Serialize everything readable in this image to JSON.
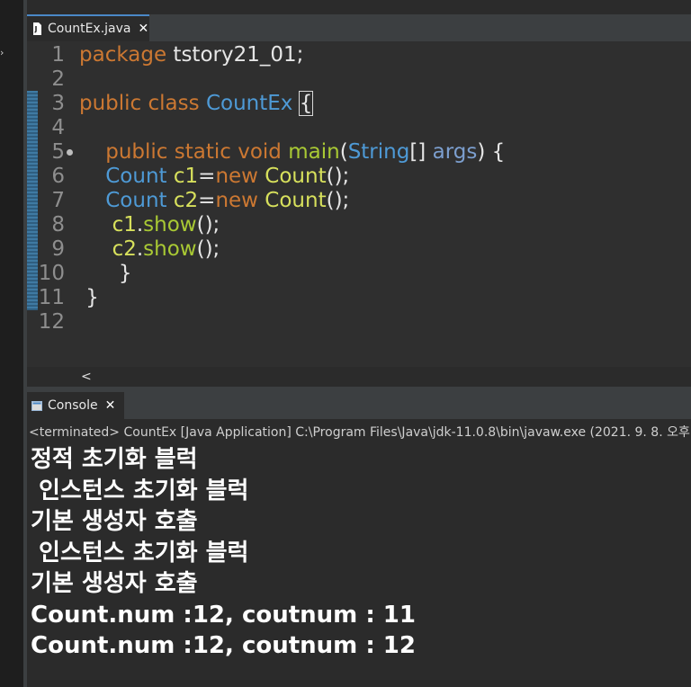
{
  "editor_tab": {
    "title": "CountEx.java",
    "close": "✕",
    "icon": "java-file-icon"
  },
  "editor": {
    "line_numbers": [
      "1",
      "2",
      "3",
      "4",
      "5",
      "6",
      "7",
      "8",
      "9",
      "10",
      "11",
      "12"
    ],
    "lines": [
      {
        "parts": [
          {
            "text": "package",
            "cls": "k"
          },
          {
            "text": " tstory21_01;",
            "cls": "w"
          }
        ]
      },
      {
        "parts": []
      },
      {
        "parts": [
          {
            "text": "public",
            "cls": "k"
          },
          {
            "text": " ",
            "cls": "w"
          },
          {
            "text": "class",
            "cls": "k"
          },
          {
            "text": " ",
            "cls": "w"
          },
          {
            "text": "CountEx",
            "cls": "t"
          },
          {
            "text": " ",
            "cls": "w"
          },
          {
            "text": "{",
            "cls": "w box"
          }
        ]
      },
      {
        "parts": []
      },
      {
        "parts": [
          {
            "text": "    ",
            "cls": "w"
          },
          {
            "text": "public",
            "cls": "k"
          },
          {
            "text": " ",
            "cls": "w"
          },
          {
            "text": "static",
            "cls": "k"
          },
          {
            "text": " ",
            "cls": "w"
          },
          {
            "text": "void",
            "cls": "k"
          },
          {
            "text": " ",
            "cls": "w"
          },
          {
            "text": "main",
            "cls": "m"
          },
          {
            "text": "(",
            "cls": "w"
          },
          {
            "text": "String",
            "cls": "t"
          },
          {
            "text": "[] ",
            "cls": "w"
          },
          {
            "text": "args",
            "cls": "p"
          },
          {
            "text": ") {",
            "cls": "w"
          }
        ]
      },
      {
        "parts": [
          {
            "text": "    ",
            "cls": "w"
          },
          {
            "text": "Count",
            "cls": "t"
          },
          {
            "text": " ",
            "cls": "w"
          },
          {
            "text": "c1",
            "cls": "v"
          },
          {
            "text": "=",
            "cls": "w"
          },
          {
            "text": "new",
            "cls": "k"
          },
          {
            "text": " ",
            "cls": "w"
          },
          {
            "text": "Count",
            "cls": "v"
          },
          {
            "text": "();",
            "cls": "w"
          }
        ]
      },
      {
        "parts": [
          {
            "text": "    ",
            "cls": "w"
          },
          {
            "text": "Count",
            "cls": "t"
          },
          {
            "text": " ",
            "cls": "w"
          },
          {
            "text": "c2",
            "cls": "v"
          },
          {
            "text": "=",
            "cls": "w"
          },
          {
            "text": "new",
            "cls": "k"
          },
          {
            "text": " ",
            "cls": "w"
          },
          {
            "text": "Count",
            "cls": "v"
          },
          {
            "text": "();",
            "cls": "w"
          }
        ]
      },
      {
        "parts": [
          {
            "text": "     ",
            "cls": "w"
          },
          {
            "text": "c1",
            "cls": "v"
          },
          {
            "text": ".",
            "cls": "w"
          },
          {
            "text": "show",
            "cls": "m"
          },
          {
            "text": "();",
            "cls": "w"
          }
        ]
      },
      {
        "parts": [
          {
            "text": "     ",
            "cls": "w"
          },
          {
            "text": "c2",
            "cls": "v"
          },
          {
            "text": ".",
            "cls": "w"
          },
          {
            "text": "show",
            "cls": "m"
          },
          {
            "text": "();",
            "cls": "w"
          }
        ]
      },
      {
        "parts": [
          {
            "text": "      }",
            "cls": "w"
          }
        ]
      },
      {
        "parts": [
          {
            "text": " }",
            "cls": "w"
          }
        ]
      },
      {
        "parts": []
      }
    ],
    "hscroll_arrow": "<"
  },
  "console_tab": {
    "title": "Console",
    "close": "✕",
    "icon": "console-icon"
  },
  "console": {
    "status": "<terminated> CountEx [Java Application] C:\\Program Files\\Java\\jdk-11.0.8\\bin\\javaw.exe  (2021. 9. 8. 오후",
    "output": [
      "정적 초기화 블럭",
      " 인스턴스 초기화 블럭",
      "기본 생성자 호출",
      " 인스턴스 초기화 블럭",
      "기본 생성자 호출",
      "Count.num :12, coutnum : 11",
      "Count.num :12, coutnum : 12"
    ]
  },
  "colors": {
    "keyword": "#cc7832",
    "type": "#4e9ad6",
    "method": "#a9c934",
    "param": "#7c9fcf",
    "variable": "#d7e05c",
    "background": "#2b2b2b"
  }
}
